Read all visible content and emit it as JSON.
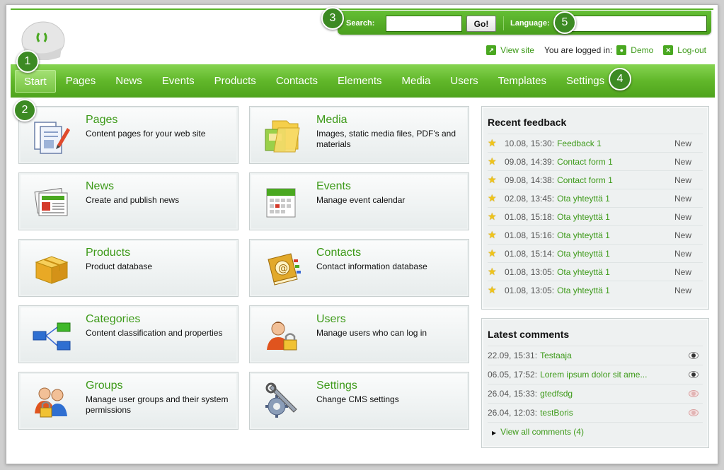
{
  "search": {
    "label": "Search:",
    "value": "",
    "go": "Go!"
  },
  "language": {
    "label": "Language:",
    "value": ""
  },
  "userbar": {
    "view_site": "View site",
    "logged_in_text": "You are logged in:",
    "user": "Demo",
    "logout": "Log-out"
  },
  "nav": {
    "items": [
      "Start",
      "Pages",
      "News",
      "Events",
      "Products",
      "Contacts",
      "Elements",
      "Media",
      "Users",
      "Templates",
      "Settings"
    ]
  },
  "badges": [
    "1",
    "2",
    "3",
    "4",
    "5"
  ],
  "tiles": [
    {
      "title": "Pages",
      "desc": "Content pages for your web site",
      "icon": "pages-icon"
    },
    {
      "title": "Media",
      "desc": "Images, static media files, PDF's and materials",
      "icon": "media-folder-icon"
    },
    {
      "title": "News",
      "desc": "Create and publish news",
      "icon": "newspaper-icon"
    },
    {
      "title": "Events",
      "desc": "Manage event calendar",
      "icon": "calendar-icon"
    },
    {
      "title": "Products",
      "desc": "Product database",
      "icon": "box-icon"
    },
    {
      "title": "Contacts",
      "desc": "Contact information database",
      "icon": "address-book-icon"
    },
    {
      "title": "Categories",
      "desc": "Content classification and properties",
      "icon": "hierarchy-icon"
    },
    {
      "title": "Users",
      "desc": "Manage users who can log in",
      "icon": "user-lock-icon"
    },
    {
      "title": "Groups",
      "desc": "Manage user groups and their system permissions",
      "icon": "group-lock-icon"
    },
    {
      "title": "Settings",
      "desc": "Change CMS settings",
      "icon": "tools-icon"
    }
  ],
  "feedback": {
    "title": "Recent feedback",
    "rows": [
      {
        "time": "10.08, 15:30:",
        "name": "Feedback 1",
        "status": "New"
      },
      {
        "time": "09.08, 14:39:",
        "name": "Contact form 1",
        "status": "New"
      },
      {
        "time": "09.08, 14:38:",
        "name": "Contact form 1",
        "status": "New"
      },
      {
        "time": "02.08, 13:45:",
        "name": "Ota yhteyttä 1",
        "status": "New"
      },
      {
        "time": "01.08, 15:18:",
        "name": "Ota yhteyttä 1",
        "status": "New"
      },
      {
        "time": "01.08, 15:16:",
        "name": "Ota yhteyttä 1",
        "status": "New"
      },
      {
        "time": "01.08, 15:14:",
        "name": "Ota yhteyttä 1",
        "status": "New"
      },
      {
        "time": "01.08, 13:05:",
        "name": "Ota yhteyttä 1",
        "status": "New"
      },
      {
        "time": "01.08, 13:05:",
        "name": "Ota yhteyttä 1",
        "status": "New"
      }
    ]
  },
  "comments": {
    "title": "Latest comments",
    "rows": [
      {
        "time": "22.09, 15:31:",
        "text": "Testaaja",
        "published": true
      },
      {
        "time": "06.05, 17:52:",
        "text": "Lorem ipsum dolor sit ame...",
        "published": true
      },
      {
        "time": "26.04, 15:33:",
        "text": "gtedfsdg",
        "published": false
      },
      {
        "time": "26.04, 12:03:",
        "text": "testBoris",
        "published": false
      }
    ],
    "view_all": "View all comments (4)"
  },
  "colors": {
    "accent": "#5ab52b",
    "link": "#3d9a19",
    "badge": "#3c8a23"
  }
}
